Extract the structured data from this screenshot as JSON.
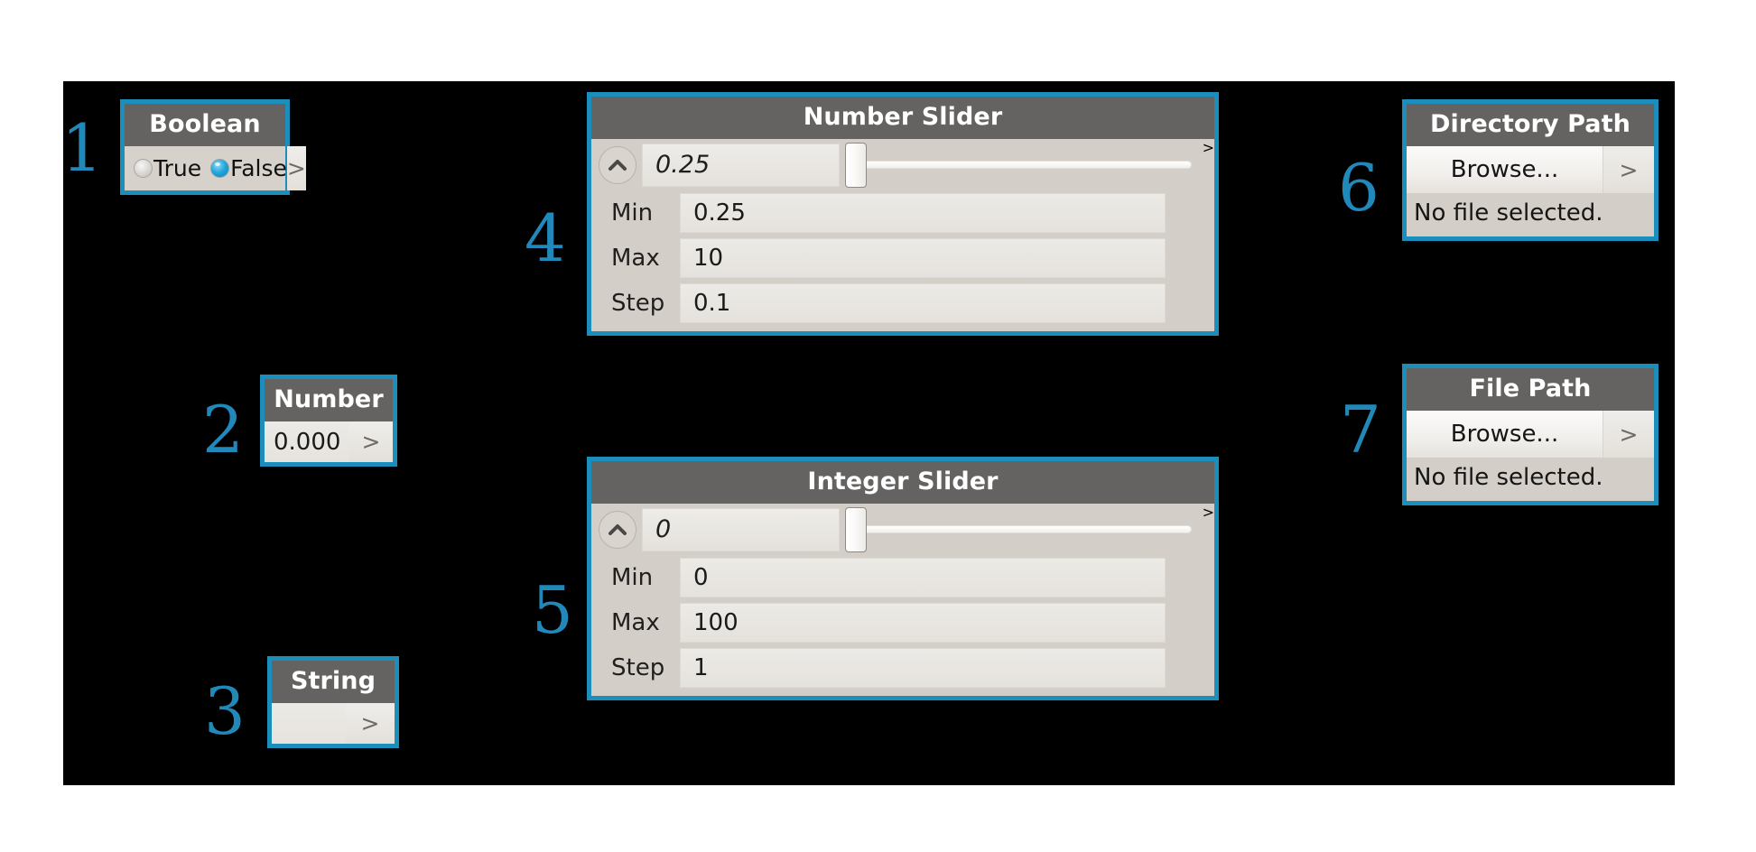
{
  "theme": {
    "accent": "#1b8ebc",
    "backdrop": "#000000",
    "title_bar": "#656361",
    "card_body": "#d3cfc8",
    "annotation_color": "#2189ba"
  },
  "annotations": [
    {
      "label": "1",
      "target": "boolean"
    },
    {
      "label": "2",
      "target": "number"
    },
    {
      "label": "3",
      "target": "string"
    },
    {
      "label": "4",
      "target": "number-slider"
    },
    {
      "label": "5",
      "target": "integer-slider"
    },
    {
      "label": "6",
      "target": "directory-path"
    },
    {
      "label": "7",
      "target": "file-path"
    }
  ],
  "widgets": {
    "boolean": {
      "title": "Boolean",
      "options": [
        {
          "label": "True",
          "selected": false
        },
        {
          "label": "False",
          "selected": true
        }
      ],
      "expander": ">"
    },
    "number": {
      "title": "Number",
      "value": "0.000",
      "expander": ">"
    },
    "string": {
      "title": "String",
      "value": "",
      "placeholder": "",
      "expander": ">"
    },
    "number_slider": {
      "title": "Number Slider",
      "value": "0.25",
      "collapse_icon": "chevron-up-icon",
      "expander": ">",
      "params": [
        {
          "label": "Min",
          "value": "0.25",
          "italic": false
        },
        {
          "label": "Max",
          "value": "10",
          "italic": false
        },
        {
          "label": "Step",
          "value": "0.1",
          "italic": false
        }
      ],
      "slider": {
        "position_percent": 0,
        "min": 0.25,
        "max": 10,
        "step": 0.1
      }
    },
    "integer_slider": {
      "title": "Integer Slider",
      "value": "0",
      "collapse_icon": "chevron-up-icon",
      "expander": ">",
      "params": [
        {
          "label": "Min",
          "value": "0",
          "italic": false
        },
        {
          "label": "Max",
          "value": "100",
          "italic": false
        },
        {
          "label": "Step",
          "value": "1",
          "italic": true
        }
      ],
      "slider": {
        "position_percent": 0,
        "min": 0,
        "max": 100,
        "step": 1
      }
    },
    "directory_path": {
      "title": "Directory Path",
      "browse_label": "Browse...",
      "status": "No file selected.",
      "expander": ">"
    },
    "file_path": {
      "title": "File Path",
      "browse_label": "Browse...",
      "status": "No file selected.",
      "expander": ">"
    }
  }
}
